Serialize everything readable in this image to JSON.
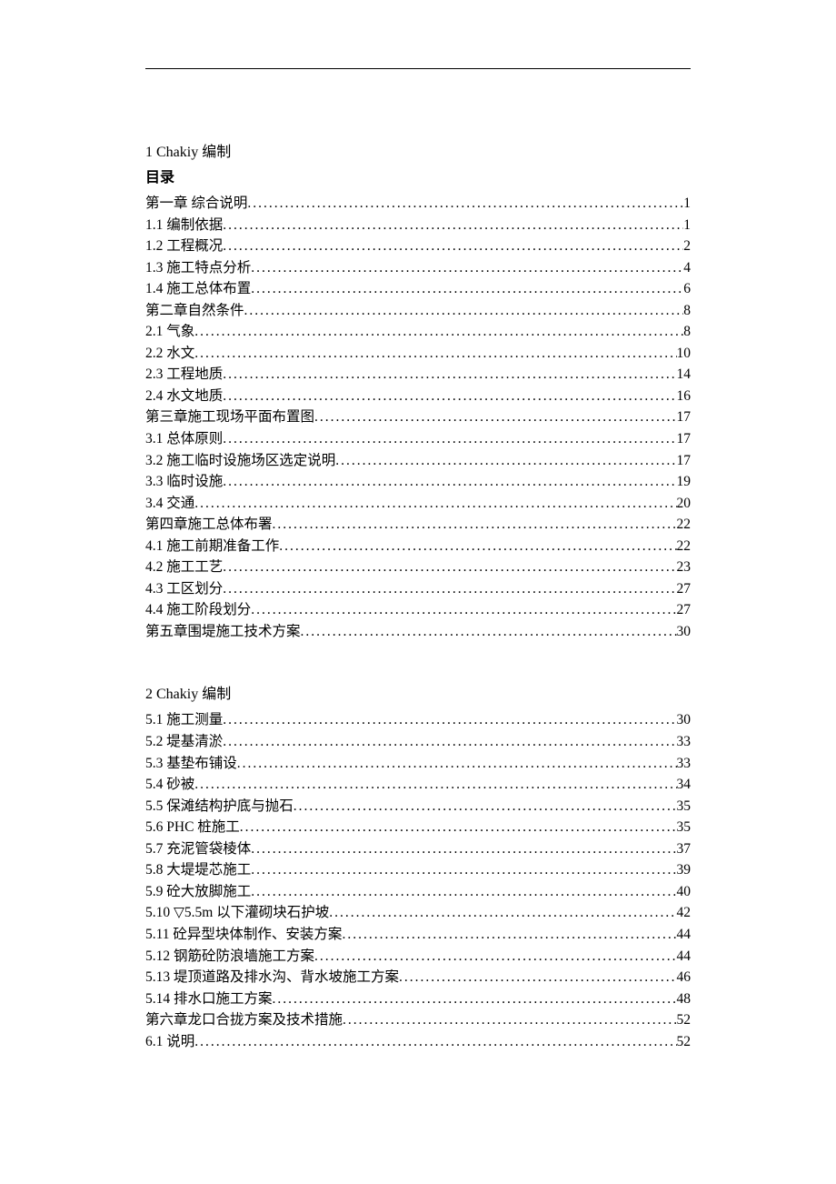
{
  "headers": {
    "block1": "1 Chakiy 编制",
    "toc_title": "目录",
    "block2": "2 Chakiy 编制"
  },
  "block1_entries": [
    {
      "label": "第一章 综合说明",
      "page": "1"
    },
    {
      "label": "1.1 编制依据",
      "page": "1"
    },
    {
      "label": "1.2 工程概况",
      "page": "2"
    },
    {
      "label": "1.3 施工特点分析",
      "page": "4"
    },
    {
      "label": "1.4 施工总体布置",
      "page": "6"
    },
    {
      "label": "第二章自然条件",
      "page": "8"
    },
    {
      "label": "2.1 气象",
      "page": "8"
    },
    {
      "label": "2.2 水文",
      "page": "10"
    },
    {
      "label": "2.3 工程地质",
      "page": "14"
    },
    {
      "label": "2.4 水文地质",
      "page": "16"
    },
    {
      "label": "第三章施工现场平面布置图",
      "page": "17"
    },
    {
      "label": "3.1 总体原则",
      "page": "17"
    },
    {
      "label": "3.2 施工临时设施场区选定说明",
      "page": "17"
    },
    {
      "label": "3.3 临时设施",
      "page": "19"
    },
    {
      "label": "3.4 交通",
      "page": "20"
    },
    {
      "label": "第四章施工总体布署",
      "page": "22"
    },
    {
      "label": "4.1 施工前期准备工作",
      "page": "22"
    },
    {
      "label": "4.2 施工工艺",
      "page": "23"
    },
    {
      "label": "4.3 工区划分",
      "page": "27"
    },
    {
      "label": "4.4 施工阶段划分",
      "page": "27"
    },
    {
      "label": "第五章围堤施工技术方案",
      "page": "30"
    }
  ],
  "block2_entries": [
    {
      "label": "5.1 施工测量",
      "page": "30"
    },
    {
      "label": "5.2 堤基清淤",
      "page": "33"
    },
    {
      "label": "5.3 基垫布铺设",
      "page": "33"
    },
    {
      "label": "5.4 砂被",
      "page": "34"
    },
    {
      "label": "5.5 保滩结构护底与抛石",
      "page": "35"
    },
    {
      "label": "5.6 PHC 桩施工",
      "page": "35"
    },
    {
      "label": "5.7 充泥管袋棱体",
      "page": "37"
    },
    {
      "label": "5.8 大堤堤芯施工",
      "page": "39"
    },
    {
      "label": "5.9 砼大放脚施工",
      "page": "40"
    },
    {
      "label": "5.10 ▽5.5m 以下灌砌块石护坡",
      "page": "42"
    },
    {
      "label": "5.11 砼异型块体制作、安装方案",
      "page": "44"
    },
    {
      "label": "5.12 钢筋砼防浪墙施工方案",
      "page": "44"
    },
    {
      "label": "5.13 堤顶道路及排水沟、背水坡施工方案",
      "page": "46"
    },
    {
      "label": "5.14 排水口施工方案",
      "page": "48"
    },
    {
      "label": "第六章龙口合拢方案及技术措施",
      "page": "52"
    },
    {
      "label": "6.1 说明",
      "page": "52"
    }
  ]
}
